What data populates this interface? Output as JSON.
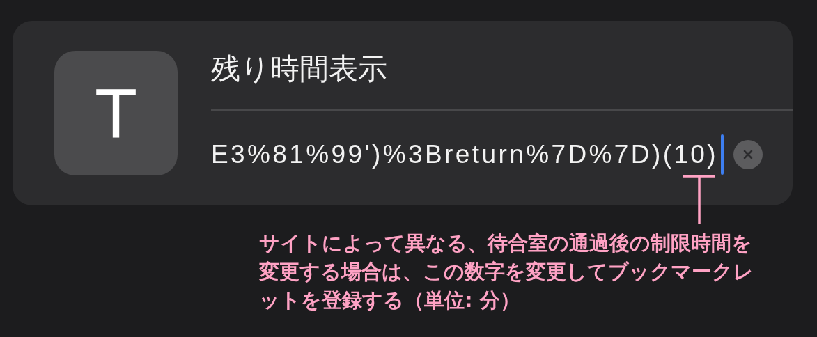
{
  "bookmark": {
    "icon_letter": "T",
    "title": "残り時間表示",
    "url": "E3%81%99')%3Breturn%7D%7D)(10)"
  },
  "annotation": {
    "text": "サイトによって異なる、待合室の通過後の制限時間を変更する場合は、この数字を変更してブックマークレットを登録する（単位: 分）"
  }
}
